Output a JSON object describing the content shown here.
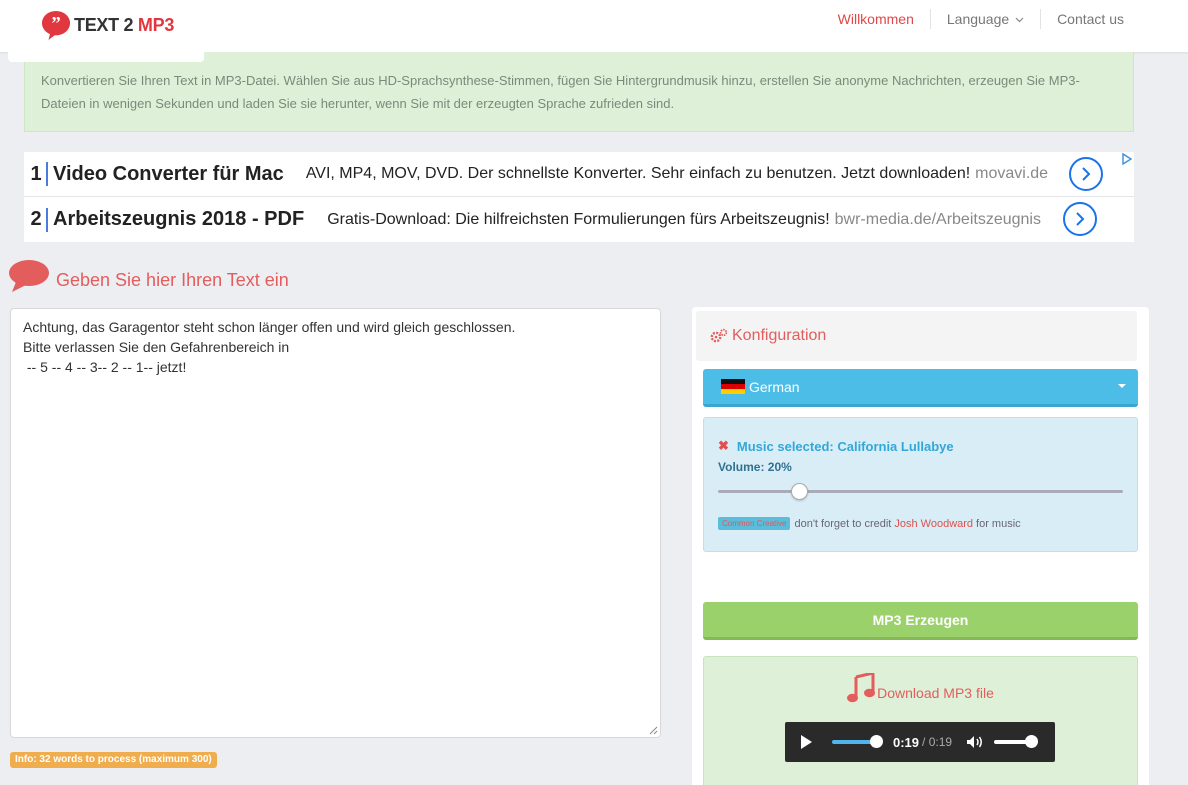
{
  "brand": {
    "logo_text_dark": "TEXT 2 ",
    "logo_text_red": "MP3",
    "accent": "#e0383e"
  },
  "nav": {
    "items": [
      "Willkommen",
      "Language",
      "Contact us"
    ]
  },
  "intro": {
    "text": "Konvertieren Sie Ihren Text in MP3-Datei. Wählen Sie aus HD-Sprachsynthese-Stimmen, fügen Sie Hintergrundmusik hinzu, erstellen Sie anonyme Nachrichten, erzeugen Sie MP3-Dateien in wenigen Sekunden und laden Sie sie herunter, wenn Sie mit der erzeugten Sprache zufrieden sind."
  },
  "ads": [
    {
      "num": "1",
      "title": "Video Converter für Mac",
      "desc": "AVI, MP4, MOV, DVD. Der schnellste Konverter. Sehr einfach zu benutzen. Jetzt downloaden!",
      "url": "movavi.de"
    },
    {
      "num": "2",
      "title": "Arbeitszeugnis 2018 - PDF",
      "desc": "Gratis-Download: Die hilfreichsten Formulierungen fürs Arbeitszeugnis!",
      "url": "bwr-media.de/Arbeitszeugnis"
    }
  ],
  "input": {
    "heading": "Geben Sie hier Ihren Text ein",
    "lines": [
      "Achtung, das Garagentor steht schon länger offen und wird gleich geschlossen.",
      "Bitte verlassen Sie den Gefahrenbereich in",
      " -- 5 -- 4 -- 3-- 2 -- 1-- jetzt!"
    ],
    "info": "Info: 32 words to process (maximum 300)"
  },
  "config": {
    "heading": "Konfiguration",
    "language": "German",
    "music_selected": "Music selected: California Lullabye",
    "volume_label": "Volume: 20%",
    "volume_fraction": 0.2,
    "cc_badge": "Common Creative",
    "credit_pre": "don't forget to credit",
    "credit_name": "Josh Woodward",
    "credit_post": "for music",
    "generate_label": "MP3 Erzeugen",
    "download_label": "Download MP3 file"
  },
  "player": {
    "current": "0:19",
    "duration": "/ 0:19"
  }
}
